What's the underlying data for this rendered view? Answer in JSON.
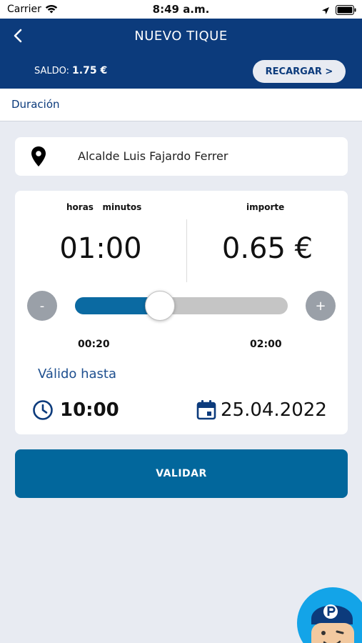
{
  "status": {
    "carrier": "Carrier",
    "time": "8:49 a.m."
  },
  "header": {
    "title": "NUEVO TIQUE",
    "balance_label": "SALDO:",
    "balance_value": "1.75 €",
    "recharge_label": "RECARGAR >"
  },
  "tab": {
    "label": "Duración"
  },
  "location": {
    "street": "Alcalde Luis Fajardo Ferrer"
  },
  "ticket": {
    "hours_minutes_label": "horas   minutos",
    "amount_label": "importe",
    "duration": "01:00",
    "amount": "0.65 €",
    "minus_label": "-",
    "plus_label": "+",
    "slider_min": "00:20",
    "slider_max": "02:00",
    "slider_fraction": 0.4,
    "valid_label": "Válido hasta",
    "valid_time": "10:00",
    "valid_date": "25.04.2022"
  },
  "actions": {
    "validate_label": "VALIDAR"
  },
  "icons": [
    "wifi-icon",
    "location-arrow-icon",
    "battery-icon",
    "back-arrow-icon",
    "map-pin-icon",
    "clock-icon",
    "calendar-icon",
    "assistant-avatar-icon"
  ],
  "colors": {
    "header": "#0c3b7c",
    "primary_button": "#02679c",
    "slider_fill": "#0b6aa2",
    "background": "#e8ebf2"
  }
}
